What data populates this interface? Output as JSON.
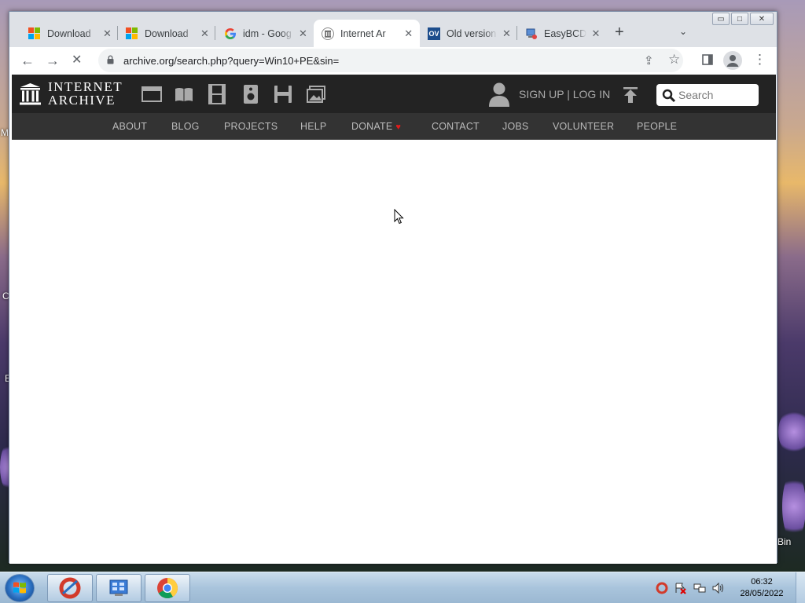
{
  "desktop": {
    "labels": [
      "M",
      "C",
      "E",
      "Bin"
    ]
  },
  "browser": {
    "tabs": [
      {
        "title": "Download",
        "favicon": "microsoft-icon",
        "active": false
      },
      {
        "title": "Download",
        "favicon": "microsoft-icon",
        "active": false
      },
      {
        "title": "idm - Goog",
        "favicon": "google-icon",
        "active": false
      },
      {
        "title": "Internet Ar",
        "favicon": "internet-archive-icon",
        "active": true
      },
      {
        "title": "Old version",
        "favicon": "oldversion-icon",
        "active": false
      },
      {
        "title": "EasyBCD -",
        "favicon": "easybcd-icon",
        "active": false
      }
    ],
    "oldversion_favicon_text": "OV",
    "tab_close": "✕",
    "new_tab": "+",
    "tab_search": "⌄",
    "window_controls": {
      "minimize": "▭",
      "maximize": "□",
      "close": "✕"
    },
    "url": "archive.org/search.php?query=Win10+PE&sin=",
    "nav": {
      "back": "←",
      "forward": "→",
      "stop": "✕"
    },
    "toolbar_icons": {
      "share": "⇪",
      "star": "☆",
      "menu": "⋮"
    }
  },
  "ia": {
    "logo_line1": "INTERNET",
    "logo_line2": "ARCHIVE",
    "account_link": "SIGN UP | LOG IN",
    "search_placeholder": "Search",
    "nav": [
      "ABOUT",
      "BLOG",
      "PROJECTS",
      "HELP",
      "DONATE",
      "CONTACT",
      "JOBS",
      "VOLUNTEER",
      "PEOPLE"
    ],
    "donate_heart": "♥"
  },
  "taskbar": {
    "time": "06:32",
    "date": "28/05/2022"
  },
  "colors": {
    "ia_header": "#232323",
    "ia_nav": "#333333",
    "donate_heart": "#e21a1a",
    "chrome_tabstrip": "#dee1e6"
  }
}
